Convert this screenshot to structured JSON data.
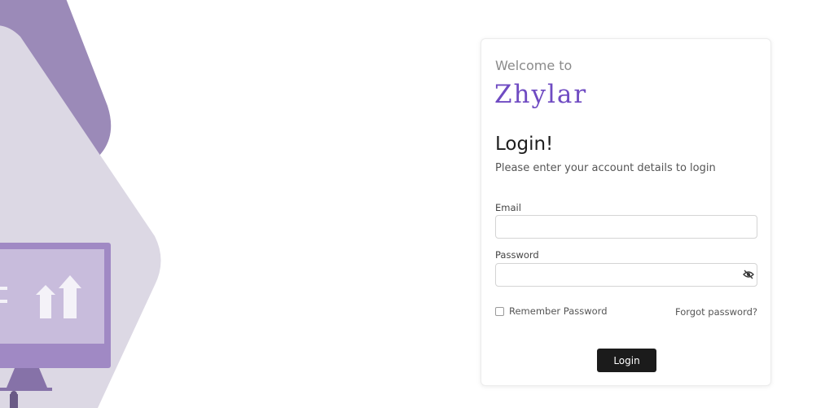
{
  "colors": {
    "brand": "#6f4bc2",
    "button_bg": "#1b1b1b",
    "illustration_dark": "#9b8ab8",
    "illustration_light": "#dcd8e4",
    "illustration_screen": "#a089c4"
  },
  "illustration": {
    "icon": "growth-chart-monitor-icon"
  },
  "card": {
    "welcome": "Welcome to",
    "brand": "Zhylar",
    "title": "Login!",
    "subtitle": "Please enter your account details to login"
  },
  "form": {
    "email_label": "Email",
    "email_value": "",
    "password_label": "Password",
    "password_value": "",
    "password_toggle_icon": "eye-slash-icon",
    "remember_label": "Remember Password",
    "remember_checked": false,
    "forgot_label": "Forgot password?",
    "login_label": "Login"
  }
}
